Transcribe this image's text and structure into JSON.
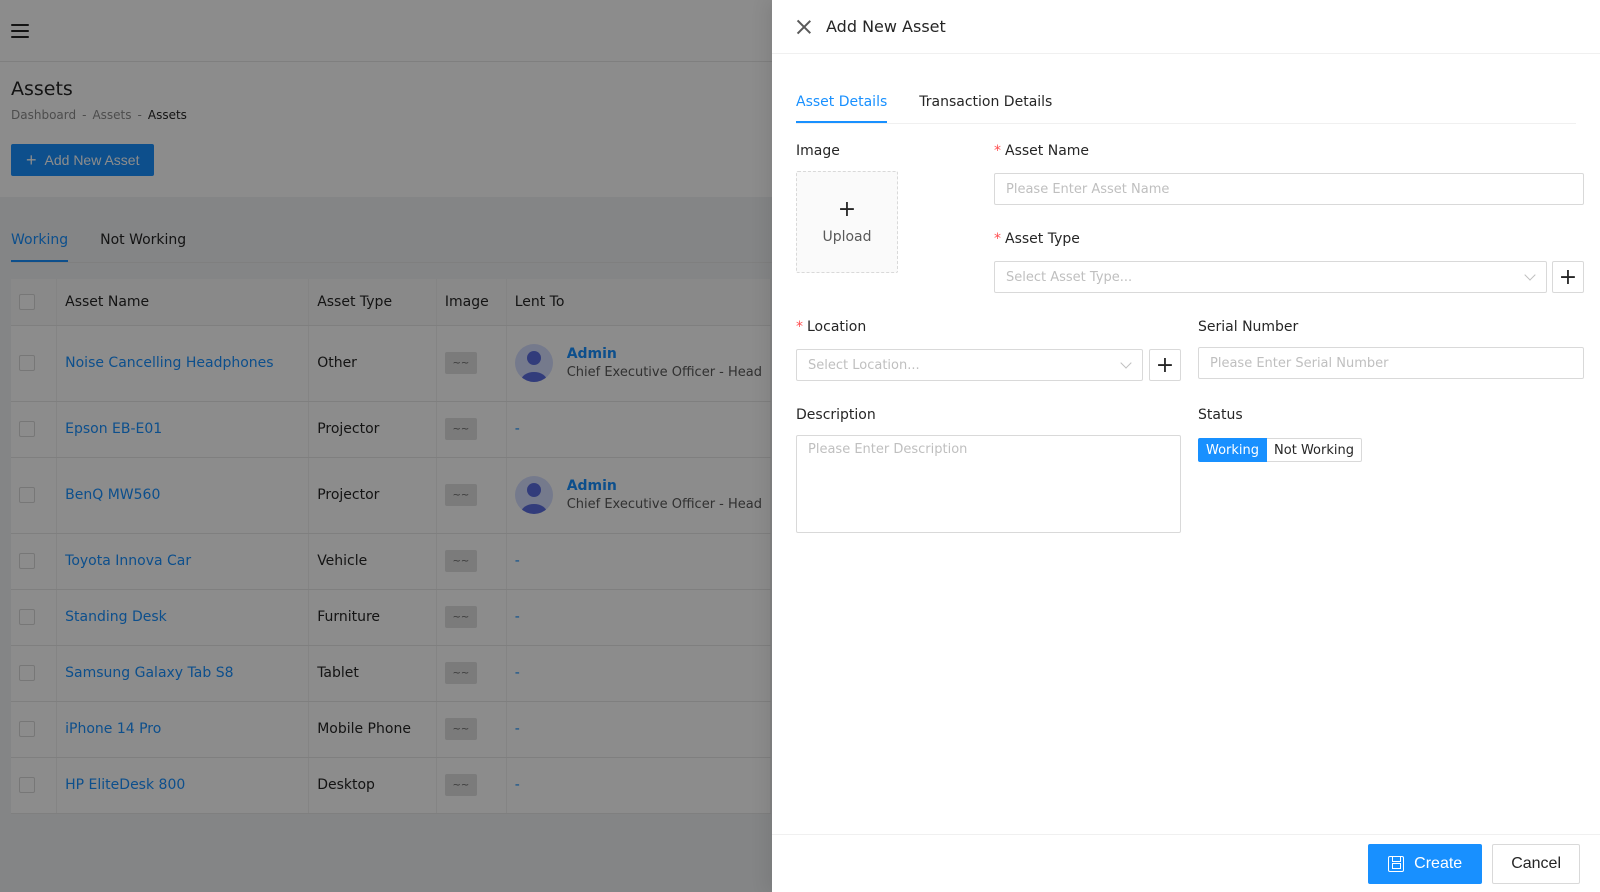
{
  "background": {
    "page_title": "Assets",
    "breadcrumb": [
      "Dashboard",
      "Assets",
      "Assets"
    ],
    "breadcrumb_sep": "-",
    "add_button_label": "Add New Asset",
    "tabs": [
      "Working",
      "Not Working"
    ],
    "table": {
      "headers": [
        "Asset Name",
        "Asset Type",
        "Image",
        "Lent To"
      ],
      "rows": [
        {
          "name": "Noise Cancelling Headphones",
          "type": "Other",
          "image": "~~",
          "lent_name": "Admin",
          "lent_role": "Chief Executive Officer - Head",
          "lent_dash": ""
        },
        {
          "name": "Epson EB-E01",
          "type": "Projector",
          "image": "~~",
          "lent_name": "",
          "lent_role": "",
          "lent_dash": "-"
        },
        {
          "name": "BenQ MW560",
          "type": "Projector",
          "image": "~~",
          "lent_name": "Admin",
          "lent_role": "Chief Executive Officer - Head",
          "lent_dash": ""
        },
        {
          "name": "Toyota Innova Car",
          "type": "Vehicle",
          "image": "~~",
          "lent_name": "",
          "lent_role": "",
          "lent_dash": "-"
        },
        {
          "name": "Standing Desk",
          "type": "Furniture",
          "image": "~~",
          "lent_name": "",
          "lent_role": "",
          "lent_dash": "-"
        },
        {
          "name": "Samsung Galaxy Tab S8",
          "type": "Tablet",
          "image": "~~",
          "lent_name": "",
          "lent_role": "",
          "lent_dash": "-"
        },
        {
          "name": "iPhone 14 Pro",
          "type": "Mobile Phone",
          "image": "~~",
          "lent_name": "",
          "lent_role": "",
          "lent_dash": "-"
        },
        {
          "name": "HP EliteDesk 800",
          "type": "Desktop",
          "image": "~~",
          "lent_name": "",
          "lent_role": "",
          "lent_dash": "-"
        }
      ]
    }
  },
  "drawer": {
    "title": "Add New Asset",
    "tabs": [
      "Asset Details",
      "Transaction Details"
    ],
    "image_label": "Image",
    "upload_label": "Upload",
    "asset_name_label": "Asset Name",
    "asset_name_placeholder": "Please Enter Asset Name",
    "asset_type_label": "Asset Type",
    "asset_type_placeholder": "Select Asset Type...",
    "location_label": "Location",
    "location_placeholder": "Select Location...",
    "serial_label": "Serial Number",
    "serial_placeholder": "Please Enter Serial Number",
    "description_label": "Description",
    "description_placeholder": "Please Enter Description",
    "status_label": "Status",
    "status_options": [
      "Working",
      "Not Working"
    ],
    "status_selected": "Working",
    "required_mark": "*",
    "create_label": "Create",
    "cancel_label": "Cancel"
  },
  "colors": {
    "primary": "#1890ff",
    "required": "#ff4d4f",
    "overlay": "rgba(0,0,0,0.45)"
  }
}
